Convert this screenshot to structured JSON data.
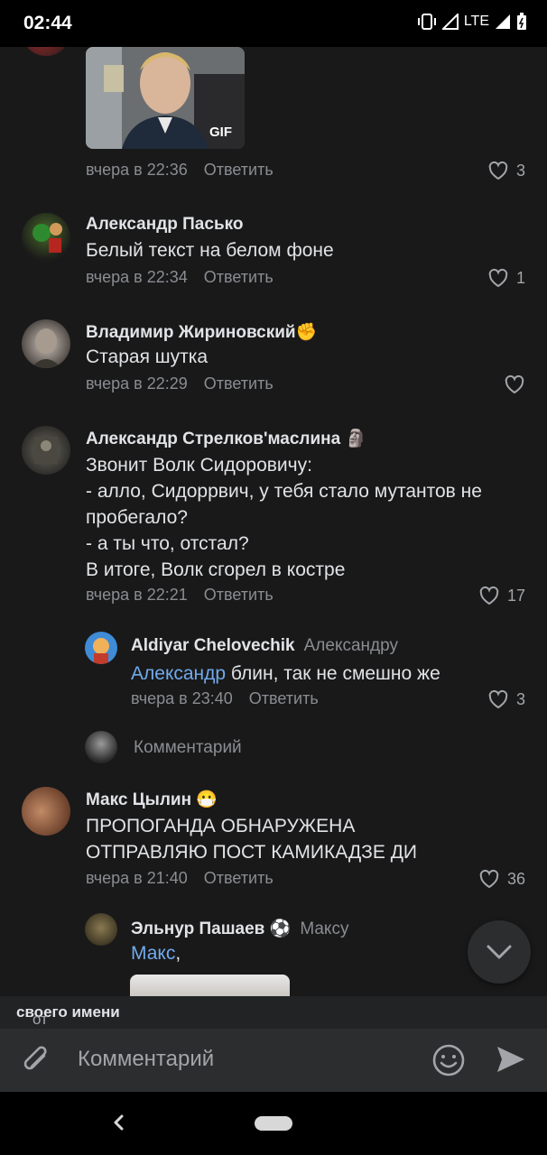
{
  "status_bar": {
    "time": "02:44",
    "network": "LTE"
  },
  "gif_comment": {
    "gif_label": "GIF",
    "date": "вчера в 22:36",
    "reply_label": "Ответить",
    "likes": "3"
  },
  "comments": [
    {
      "author": "Александр Пасько",
      "text": "Белый текст на белом фоне",
      "date": "вчера в 22:34",
      "reply_label": "Ответить",
      "likes": "1"
    },
    {
      "author": "Владимир Жириновский",
      "emoji": "✊",
      "text": "Старая шутка",
      "date": "вчера в 22:29",
      "reply_label": "Ответить",
      "likes": ""
    },
    {
      "author": "Александр Стрелков'маслина",
      "emoji": "🗿",
      "text": "Звонит Волк Сидоровичу:\n- алло, Сидоррвич, у тебя стало мутантов не пробегало?\n- а ты что, отстал?\nВ итоге, Волк сгорел в костре",
      "date": "вчера в 22:21",
      "reply_label": "Ответить",
      "likes": "17"
    },
    {
      "author": "Макс Цылин",
      "emoji": "😷",
      "text": "ПРОПОГАНДА ОБНАРУЖЕНА\nОТПРАВЛЯЮ ПОСТ КАМИКАДЗЕ ДИ",
      "date": "вчера в 21:40",
      "reply_label": "Ответить",
      "likes": "36"
    }
  ],
  "replies": [
    {
      "author": "Aldiyar Chelovechik",
      "to": "Александру",
      "mention": "Александр",
      "text": " блин, так не смешно же",
      "date": "вчера в 23:40",
      "reply_label": "Ответить",
      "likes": "3"
    },
    {
      "author": "Эльнур Пашаев",
      "emoji": "⚽",
      "to": "Максу",
      "mention": "Макс",
      "text": ","
    }
  ],
  "inline_reply_placeholder": "Комментарий",
  "post_as": {
    "prefix": "от",
    "value": "своего имени"
  },
  "composer": {
    "placeholder": "Комментарий"
  }
}
